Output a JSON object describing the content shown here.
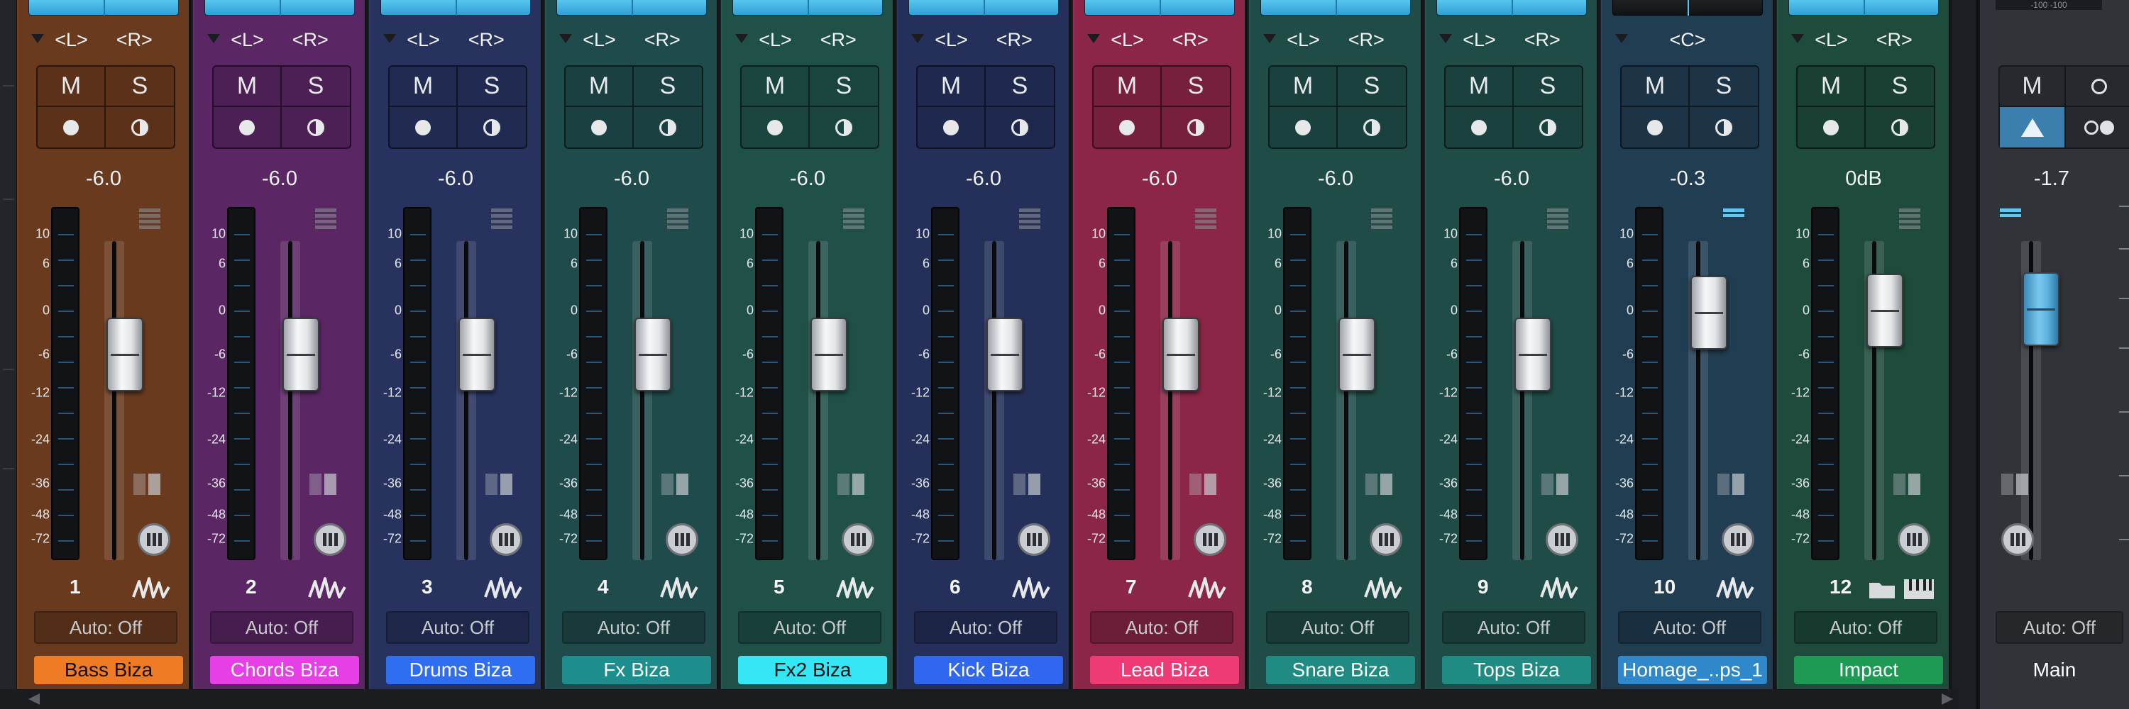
{
  "mixer": {
    "scale_labels": [
      "10",
      "6",
      "0",
      "-6",
      "-12",
      "-24",
      "-36",
      "-48",
      "-72"
    ],
    "auto_label": "Auto: Off",
    "mute_label": "M",
    "solo_label": "S",
    "channels": [
      {
        "number": "1",
        "name": "Bass Biza",
        "pan_left": "<L>",
        "pan_right": "<R>",
        "level": "-6.0",
        "fader_db": -6.0,
        "bg": "#6a3a1e",
        "name_bg": "#ef7b24"
      },
      {
        "number": "2",
        "name": "Chords Biza",
        "pan_left": "<L>",
        "pan_right": "<R>",
        "level": "-6.0",
        "fader_db": -6.0,
        "bg": "#5a2664",
        "name_bg": "#e53fe5"
      },
      {
        "number": "3",
        "name": "Drums Biza",
        "pan_left": "<L>",
        "pan_right": "<R>",
        "level": "-6.0",
        "fader_db": -6.0,
        "bg": "#27325e",
        "name_bg": "#2f6ef1"
      },
      {
        "number": "4",
        "name": "Fx Biza",
        "pan_left": "<L>",
        "pan_right": "<R>",
        "level": "-6.0",
        "fader_db": -6.0,
        "bg": "#1f4b4c",
        "name_bg": "#1d8e8d"
      },
      {
        "number": "5",
        "name": "Fx2 Biza",
        "pan_left": "<L>",
        "pan_right": "<R>",
        "level": "-6.0",
        "fader_db": -6.0,
        "bg": "#1f5149",
        "name_bg": "#35e6f4"
      },
      {
        "number": "6",
        "name": "Kick Biza",
        "pan_left": "<L>",
        "pan_right": "<R>",
        "level": "-6.0",
        "fader_db": -6.0,
        "bg": "#24305a",
        "name_bg": "#2f67f0"
      },
      {
        "number": "7",
        "name": "Lead Biza",
        "pan_left": "<L>",
        "pan_right": "<R>",
        "level": "-6.0",
        "fader_db": -6.0,
        "bg": "#8b2648",
        "name_bg": "#ef3a74"
      },
      {
        "number": "8",
        "name": "Snare Biza",
        "pan_left": "<L>",
        "pan_right": "<R>",
        "level": "-6.0",
        "fader_db": -6.0,
        "bg": "#1f4c47",
        "name_bg": "#1f8b82"
      },
      {
        "number": "9",
        "name": "Tops Biza",
        "pan_left": "<L>",
        "pan_right": "<R>",
        "level": "-6.0",
        "fader_db": -6.0,
        "bg": "#1f4c47",
        "name_bg": "#1f8b82"
      },
      {
        "number": "10",
        "name": "Homage_..ps_1",
        "pan_left": "",
        "pan_right": "",
        "pan_center": "<C>",
        "level": "-0.3",
        "fader_db": -0.3,
        "bg": "#213d52",
        "name_bg": "#2f88c9",
        "dark_plugin": true,
        "fx_active": true
      },
      {
        "number": "12",
        "name": "Impact",
        "pan_left": "<L>",
        "pan_right": "<R>",
        "level": "0dB",
        "fader_db": 0.0,
        "bg": "#1e4b3c",
        "name_bg": "#1f9a54",
        "instrument": true
      }
    ],
    "main": {
      "name": "Main",
      "level": "-1.7",
      "fader_db": -1.7,
      "auto": "Auto: Off",
      "top_readout": "-100      -100",
      "mute_label": "M"
    }
  },
  "icons": {
    "pan_arrow": "triangle-down-icon",
    "record": "record-icon",
    "monitor": "monitor-icon",
    "fx": "insert-list-icon",
    "group": "group-icon",
    "inserts": "inserts-button-icon",
    "waveform": "waveform-icon",
    "folder": "folder-icon",
    "piano": "piano-icon"
  }
}
